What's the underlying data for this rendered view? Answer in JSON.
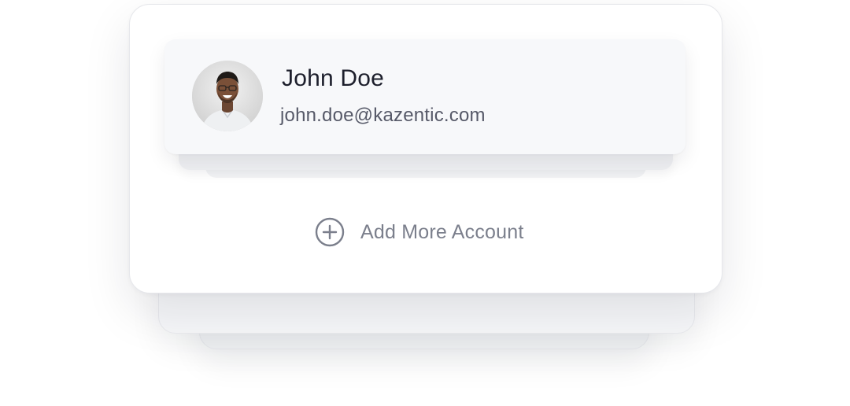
{
  "account": {
    "name": "John Doe",
    "email": "john.doe@kazentic.com",
    "avatar_icon": "user-avatar-photo"
  },
  "actions": {
    "add_account_label": "Add More Account",
    "add_account_icon": "plus-circle-icon"
  },
  "colors": {
    "name_text": "#1d1f2c",
    "email_text": "#565968",
    "action_text": "#7b7f8c",
    "card_background": "#ffffff",
    "profile_background": "#f7f8fa"
  }
}
